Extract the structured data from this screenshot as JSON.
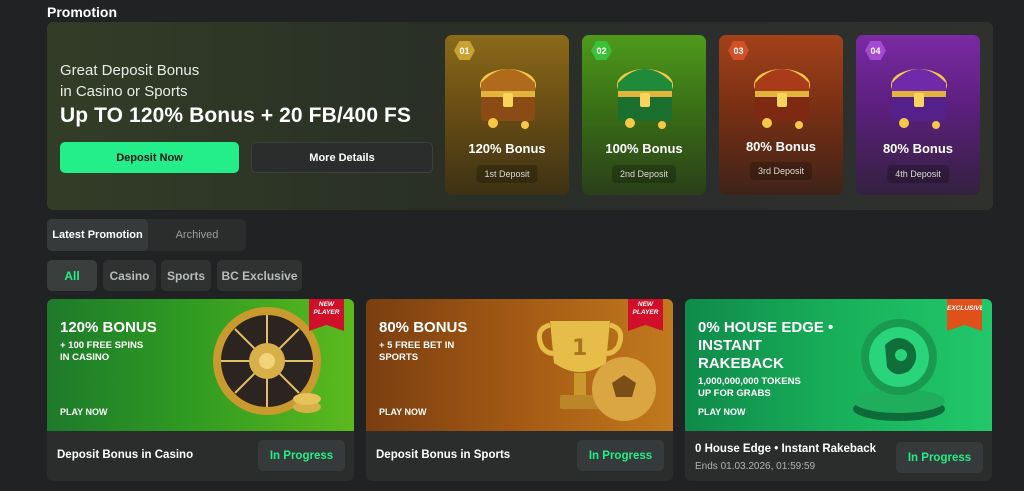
{
  "section_title": "Promotion",
  "banner": {
    "sub_line1": "Great Deposit Bonus",
    "sub_line2": "in Casino or Sports",
    "headline": "Up TO 120% Bonus + 20 FB/400 FS",
    "deposit_button": "Deposit Now",
    "details_button": "More Details",
    "accent_color": "#24ee89",
    "deposit_cards": [
      {
        "number": "01",
        "bonus": "120% Bonus",
        "label": "1st Deposit",
        "icon": "treasure-chest-icon"
      },
      {
        "number": "02",
        "bonus": "100% Bonus",
        "label": "2nd Deposit",
        "icon": "treasure-chest-icon"
      },
      {
        "number": "03",
        "bonus": "80% Bonus",
        "label": "3rd Deposit",
        "icon": "treasure-chest-icon"
      },
      {
        "number": "04",
        "bonus": "80% Bonus",
        "label": "4th Deposit",
        "icon": "treasure-chest-icon"
      }
    ]
  },
  "tabs": {
    "active": "Latest Promotion",
    "inactive": "Archived"
  },
  "filters": [
    "All",
    "Casino",
    "Sports",
    "BC Exclusive"
  ],
  "cards": [
    {
      "art_title": "120% BONUS",
      "art_sub1": "+ 100 FREE SPINS",
      "art_sub2": "IN CASINO",
      "play": "PLAY NOW",
      "ribbon1": "NEW",
      "ribbon2": "PLAYER",
      "title": "Deposit Bonus in Casino",
      "status": "In Progress",
      "icon": "roulette-wheel-icon"
    },
    {
      "art_title": "80% BONUS",
      "art_sub1": "+ 5 FREE BET IN",
      "art_sub2": "SPORTS",
      "play": "PLAY NOW",
      "ribbon1": "NEW",
      "ribbon2": "PLAYER",
      "title": "Deposit Bonus in Sports",
      "status": "In Progress",
      "icon": "trophy-ball-icon"
    },
    {
      "art_title1": "0% HOUSE EDGE •",
      "art_title2": "INSTANT",
      "art_title3": "RAKEBACK",
      "art_sub1": "1,000,000,000 TOKENS",
      "art_sub2": "UP FOR GRABS",
      "play": "PLAY NOW",
      "ribbon1": "EXCLUSIVE",
      "title": "0 House Edge • Instant Rakeback",
      "ends": "Ends 01.03.2026, 01:59:59",
      "status": "In Progress",
      "icon": "bc-token-icon"
    }
  ]
}
